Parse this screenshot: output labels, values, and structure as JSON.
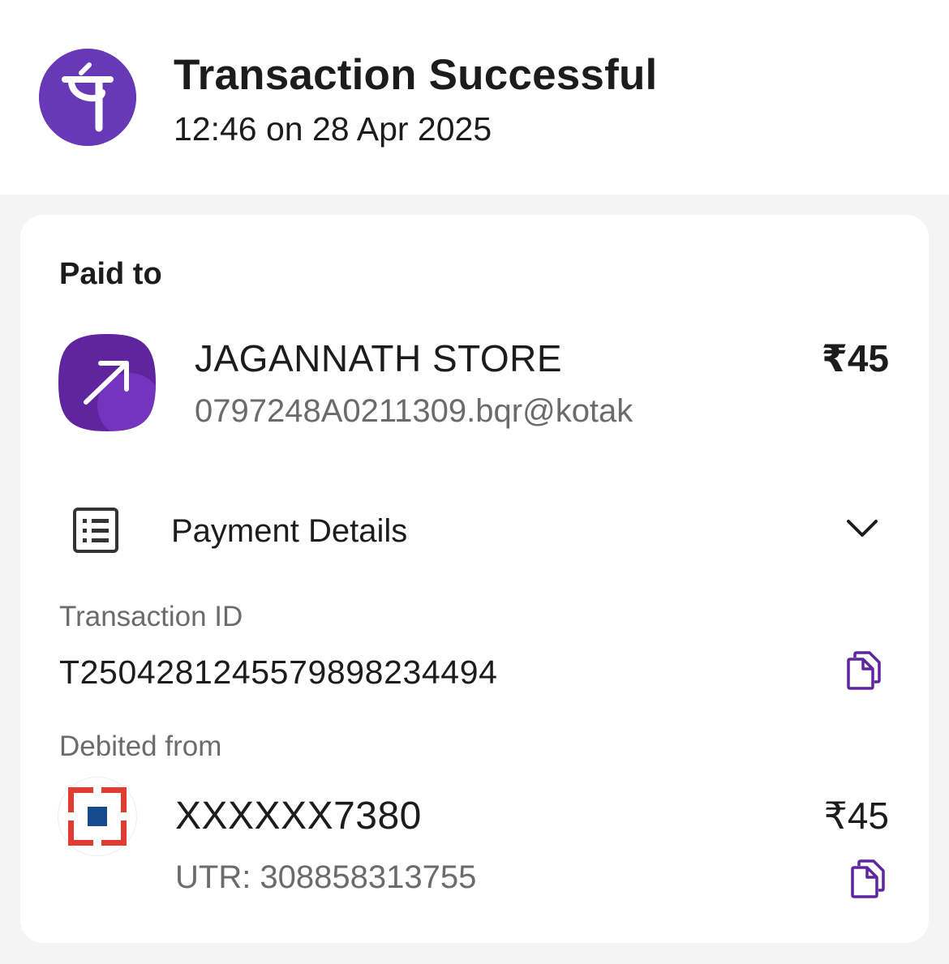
{
  "colors": {
    "brand_purple": "#6739b7",
    "icon_purple": "#5f259f",
    "text_primary": "#1c1c1c",
    "text_secondary": "#6b6b6b",
    "page_background": "#f4f4f4",
    "bank_red": "#e03c31",
    "bank_blue": "#164a8f"
  },
  "header": {
    "logo_icon": "phonepe-logo",
    "title": "Transaction Successful",
    "timestamp": "12:46 on 28 Apr 2025"
  },
  "paid_to": {
    "label": "Paid to",
    "avatar_icon": "arrow-up-right-icon",
    "merchant_name": "JAGANNATH STORE",
    "upi_id": "0797248A0211309.bqr@kotak",
    "amount": "₹45"
  },
  "payment_details": {
    "icon": "receipt-list-icon",
    "label": "Payment Details",
    "toggle_icon": "chevron-down-icon"
  },
  "transaction": {
    "label": "Transaction ID",
    "id": "T2504281245579898234494",
    "copy_icon": "copy-icon"
  },
  "debited_from": {
    "label": "Debited from",
    "bank_icon": "hdfc-bank-logo",
    "account": "XXXXXX7380",
    "utr": "UTR: 308858313755",
    "amount": "₹45",
    "copy_icon": "copy-icon"
  }
}
